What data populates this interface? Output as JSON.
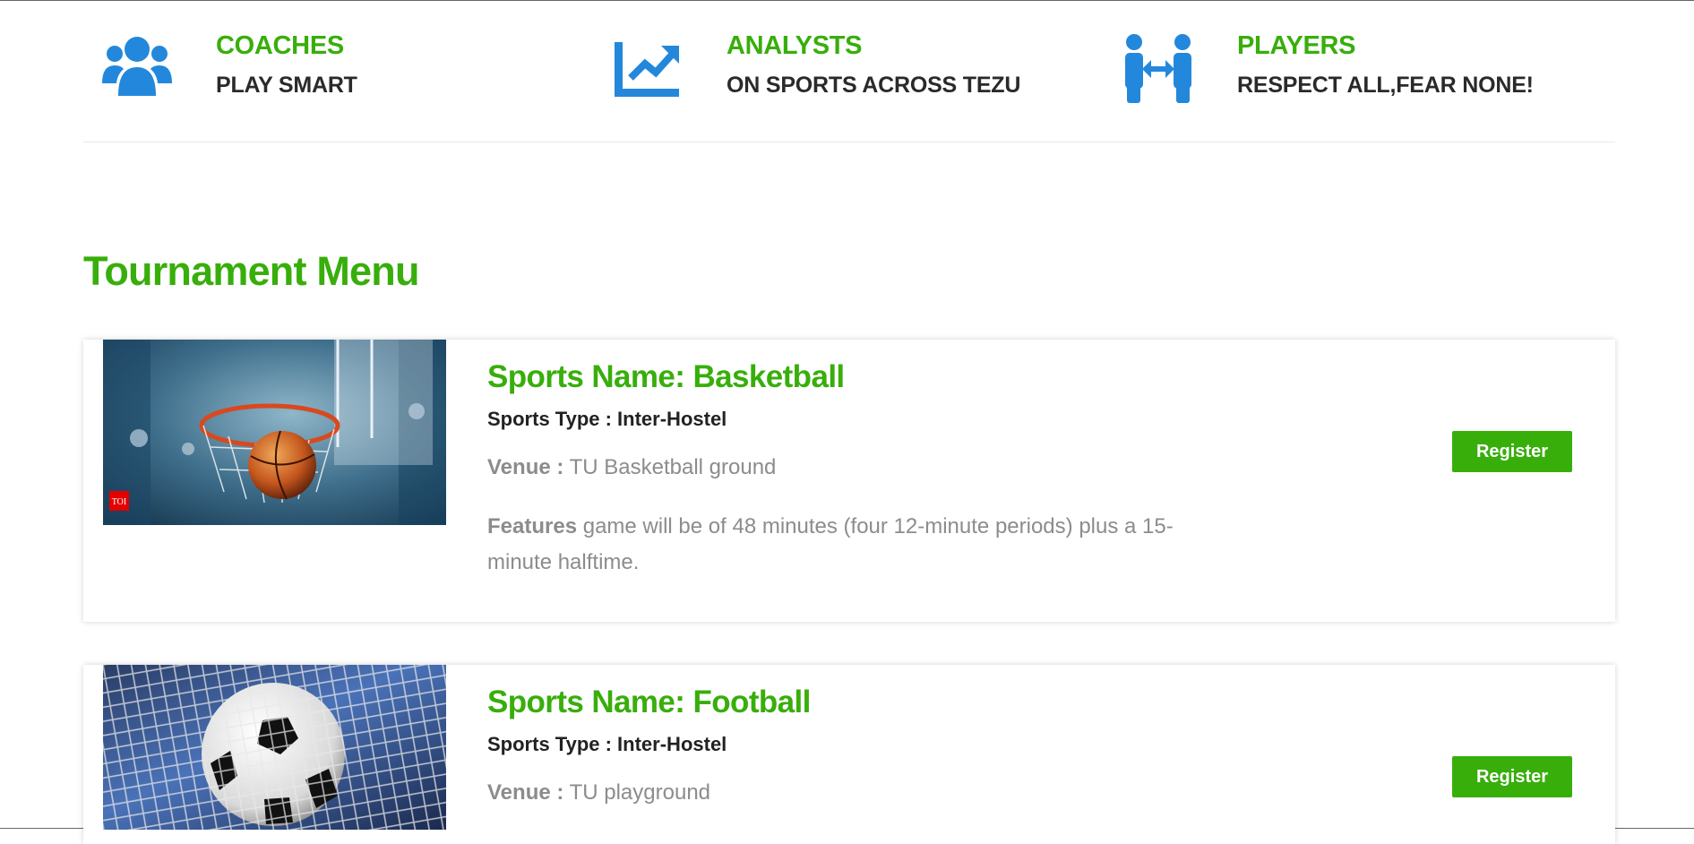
{
  "features": [
    {
      "icon": "users-group-icon",
      "title": "COACHES",
      "subtitle": "PLAY SMART"
    },
    {
      "icon": "chart-line-icon",
      "title": "ANALYSTS",
      "subtitle": "ON SPORTS ACROSS TEZU"
    },
    {
      "icon": "people-arrows-icon",
      "title": "PLAYERS",
      "subtitle": "RESPECT ALL,FEAR NONE!"
    }
  ],
  "section_title": "Tournament Menu",
  "tournaments": [
    {
      "name": "Sports Name: Basketball",
      "type": "Sports Type : Inter-Hostel",
      "venue_label": "Venue :",
      "venue": "TU Basketball ground",
      "features_label": "Features",
      "features": "game will be of 48 minutes (four 12-minute periods) plus a 15-minute halftime.",
      "image_badge": "TOI",
      "register_label": "Register"
    },
    {
      "name": "Sports Name: Football",
      "type": "Sports Type : Inter-Hostel",
      "venue_label": "Venue :",
      "venue": "TU playground",
      "register_label": "Register"
    }
  ],
  "colors": {
    "accent_green": "#38ae0b",
    "icon_blue": "#2388dc",
    "text_dark": "#2a2a2a",
    "text_muted": "#8c8c8c"
  }
}
